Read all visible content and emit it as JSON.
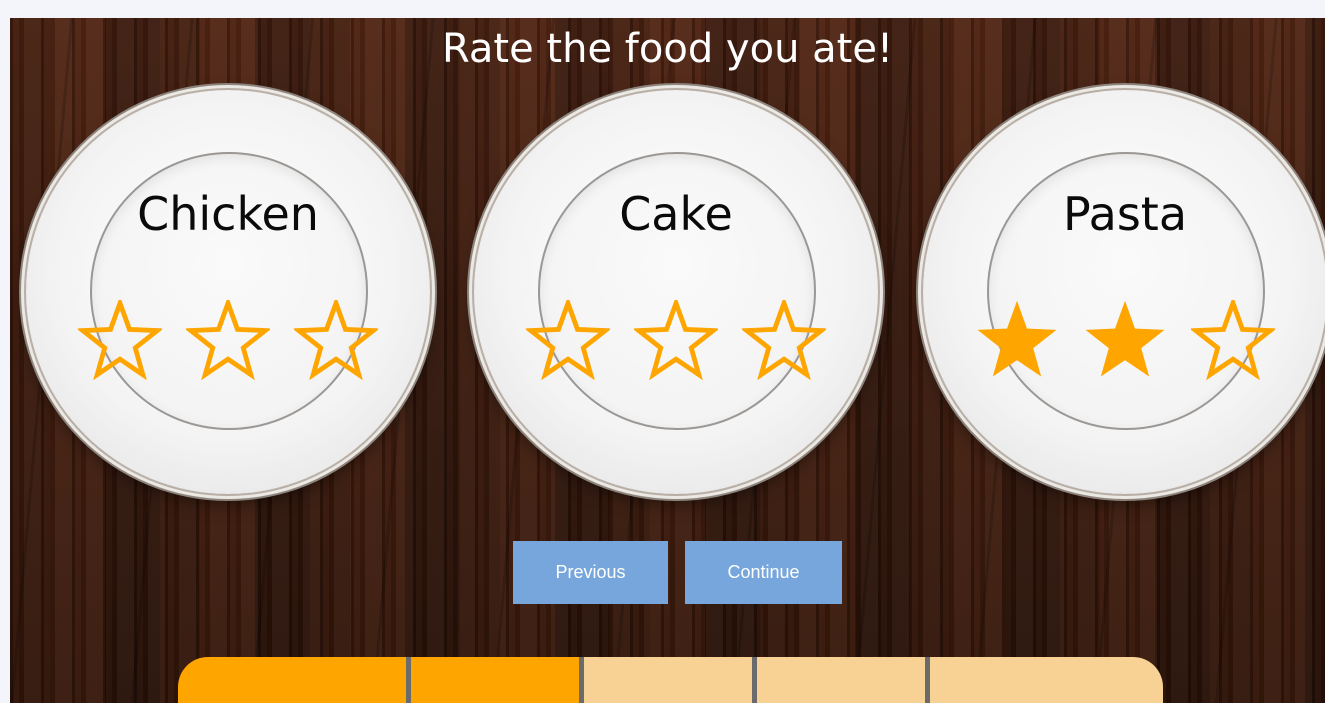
{
  "title": "Rate the food you ate!",
  "foods": [
    {
      "name": "Chicken",
      "rating": 0,
      "max": 3
    },
    {
      "name": "Cake",
      "rating": 0,
      "max": 3
    },
    {
      "name": "Pasta",
      "rating": 2,
      "max": 3
    }
  ],
  "buttons": {
    "previous": "Previous",
    "continue": "Continue"
  },
  "progress": {
    "total_steps": 5,
    "completed_steps": 2,
    "filled_color": "#ffa500",
    "empty_color": "#f8d194",
    "divider_color": "#6b6b6b"
  },
  "colors": {
    "star": "#ffa500",
    "button": "#76a6dc",
    "title": "#ffffff"
  },
  "icons": {
    "empty_star": "star-outline-icon",
    "filled_star": "star-filled-icon"
  }
}
